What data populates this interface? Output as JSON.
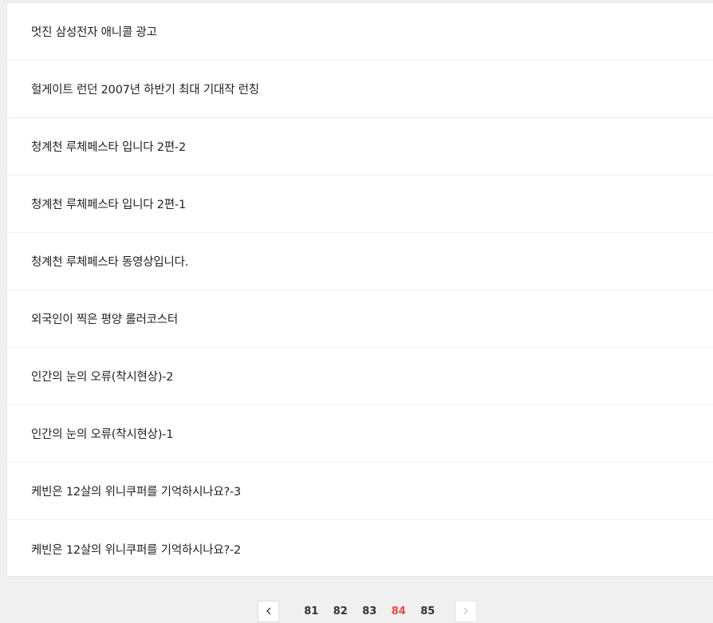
{
  "posts": [
    {
      "title": "멋진 삼성전자 애니콜 광고"
    },
    {
      "title": "헐게이트 런던 2007년 하반기 최대 기대작 런칭"
    },
    {
      "title": "청계천 루체페스타 입니다 2편-2"
    },
    {
      "title": "청계천 루체페스타 입니다 2편-1"
    },
    {
      "title": "청계천 루체페스타 동영상입니다."
    },
    {
      "title": "외국인이 찍은 평양 롤러코스터"
    },
    {
      "title": "인간의 눈의 오류(착시현상)-2"
    },
    {
      "title": "인간의 눈의 오류(착시현상)-1"
    },
    {
      "title": "케빈은 12살의 위니쿠퍼를 기억하시나요?-3"
    },
    {
      "title": "케빈은 12살의 위니쿠퍼를 기억하시나요?-2"
    }
  ],
  "pagination": {
    "pages": [
      "81",
      "82",
      "83",
      "84",
      "85"
    ],
    "current": "84",
    "prev_icon": "chevron-left-icon",
    "next_icon": "chevron-right-icon"
  },
  "colors": {
    "accent": "#f2463e",
    "background": "#f0f0f1",
    "card": "#ffffff",
    "text": "#222226"
  }
}
